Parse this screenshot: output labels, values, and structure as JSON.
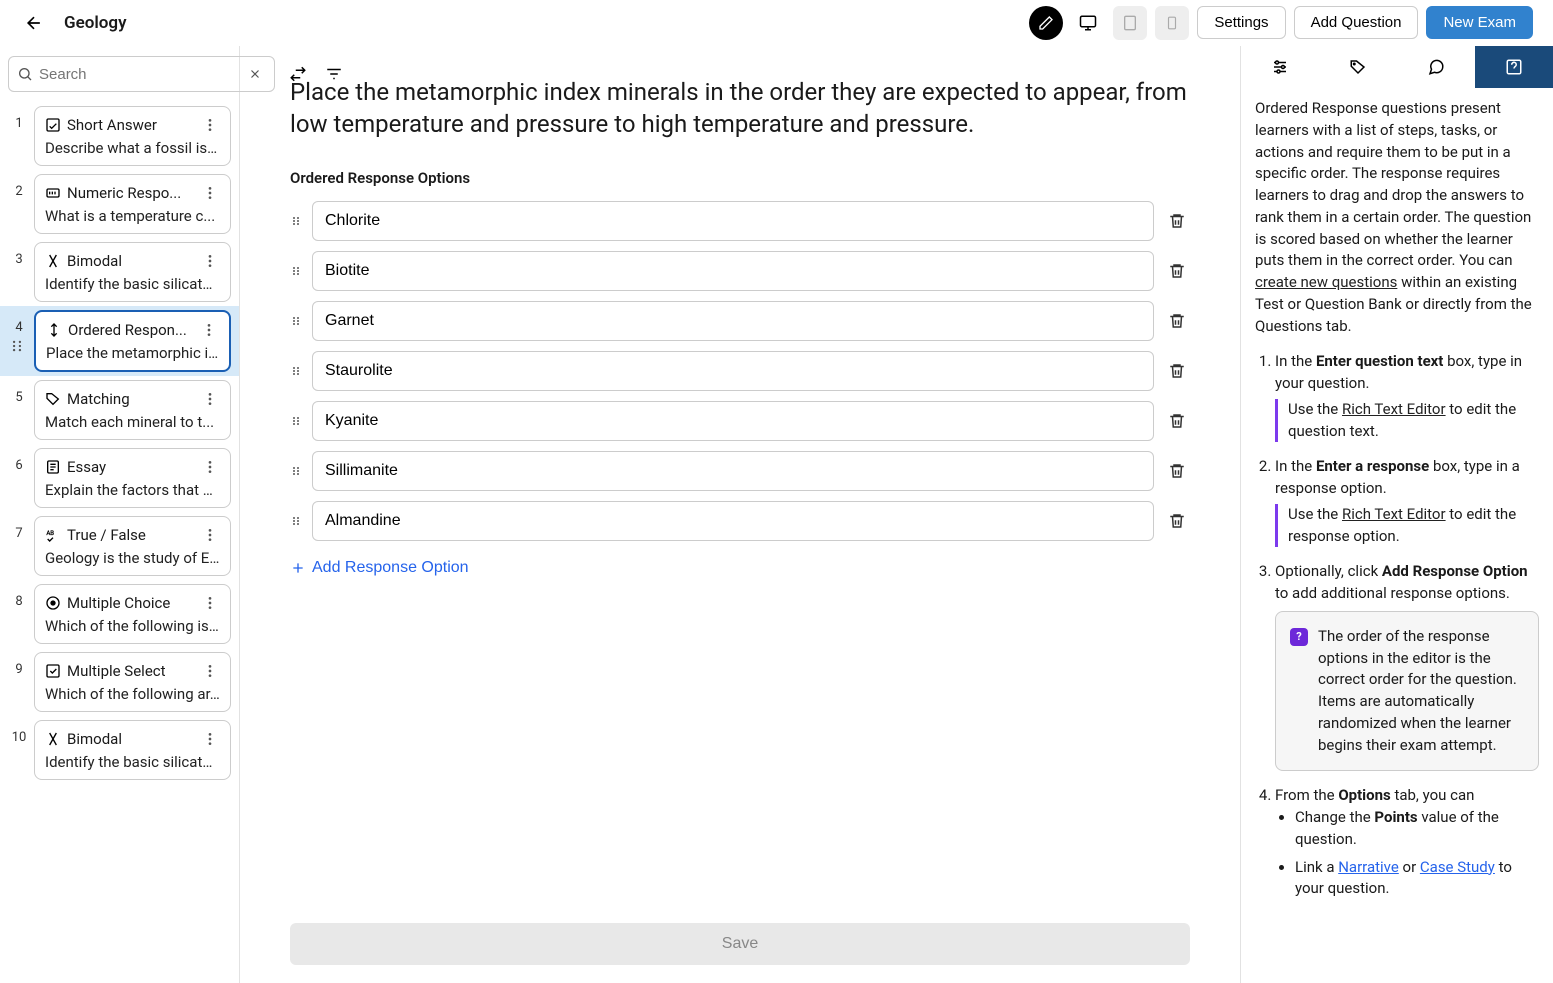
{
  "header": {
    "title": "Geology",
    "settings": "Settings",
    "add_question": "Add Question",
    "new_exam": "New Exam"
  },
  "search": {
    "placeholder": "Search"
  },
  "questions": [
    {
      "num": "1",
      "type": "Short Answer",
      "icon": "shortanswer",
      "desc": "Describe what a fossil is ..."
    },
    {
      "num": "2",
      "type": "Numeric Respo...",
      "icon": "numeric",
      "desc": "What is a temperature c..."
    },
    {
      "num": "3",
      "type": "Bimodal",
      "icon": "bimodal",
      "desc": "Identify the basic silicate..."
    },
    {
      "num": "4",
      "type": "Ordered Respon...",
      "icon": "ordered",
      "desc": "Place the metamorphic i...",
      "selected": true
    },
    {
      "num": "5",
      "type": "Matching",
      "icon": "matching",
      "desc": "Match each mineral to t..."
    },
    {
      "num": "6",
      "type": "Essay",
      "icon": "essay",
      "desc": "Explain the factors that c..."
    },
    {
      "num": "7",
      "type": "True / False",
      "icon": "truefalse",
      "desc": "Geology is the study of E..."
    },
    {
      "num": "8",
      "type": "Multiple Choice",
      "icon": "mc",
      "desc": "Which of the following is..."
    },
    {
      "num": "9",
      "type": "Multiple Select",
      "icon": "ms",
      "desc": "Which of the following ar..."
    },
    {
      "num": "10",
      "type": "Bimodal",
      "icon": "bimodal",
      "desc": "Identify the basic silicate..."
    }
  ],
  "editor": {
    "prompt": "Place the metamorphic index minerals in the order they are expected to appear, from low temperature and pressure to high temperature and pressure.",
    "section_label": "Ordered Response Options",
    "options": [
      "Chlorite",
      "Biotite",
      "Garnet",
      "Staurolite",
      "Kyanite",
      "Sillimanite",
      "Almandine"
    ],
    "add_option": "Add Response Option",
    "save": "Save"
  },
  "help": {
    "intro_a": "Ordered Response questions present learners with a list of steps, tasks, or actions and require them to be put in a specific order. The response requires learners to drag and drop the answers to rank them in a certain order. The question is scored based on whether the learner puts them in the correct order. You can ",
    "intro_link": "create new questions",
    "intro_b": " within an existing Test or Question Bank or directly from the Questions tab.",
    "step1_a": "In the ",
    "step1_b": "Enter question text",
    "step1_c": " box, type in your question.",
    "step1_hint_a": "Use the ",
    "step1_hint_link": "Rich Text Editor",
    "step1_hint_b": " to edit the question text.",
    "step2_a": "In the ",
    "step2_b": "Enter a response",
    "step2_c": " box, type in a response option.",
    "step2_hint_a": "Use the ",
    "step2_hint_link": "Rich Text Editor",
    "step2_hint_b": " to edit the response option.",
    "step3_a": "Optionally, click ",
    "step3_b": "Add Response Option",
    "step3_c": " to add additional response options.",
    "note": "The order of the response options in the editor is the correct order for the question. Items are automatically randomized when the learner begins their exam attempt.",
    "step4_a": "From the ",
    "step4_b": "Options",
    "step4_c": " tab, you can",
    "sub_a1": "Change the ",
    "sub_a2": "Points",
    "sub_a3": " value of the question.",
    "sub_b1": "Link a ",
    "sub_b2": "Narrative",
    "sub_b3": " or ",
    "sub_b4": "Case Study",
    "sub_b5": " to your question."
  }
}
